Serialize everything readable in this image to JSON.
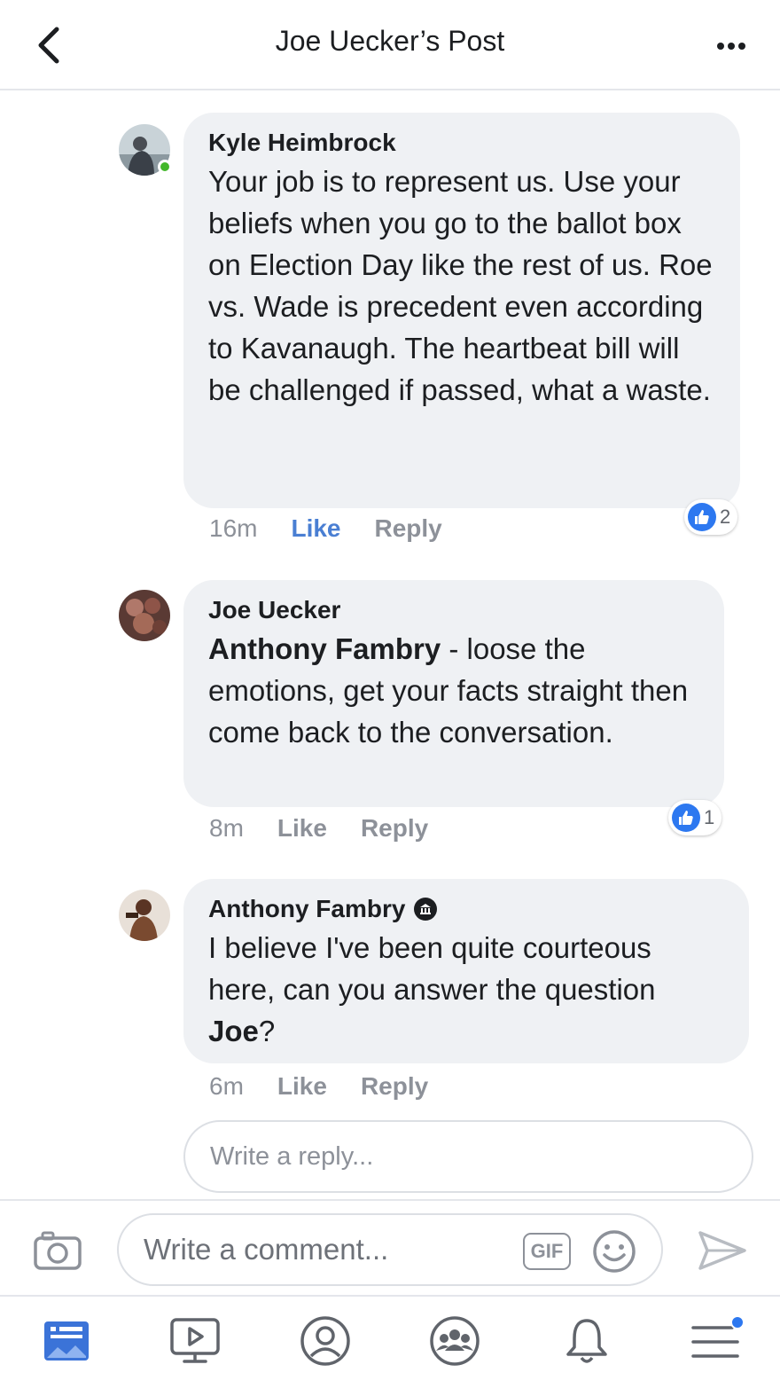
{
  "header": {
    "title": "Joe Uecker’s Post"
  },
  "comments": [
    {
      "author": "Kyle Heimbrock",
      "text": "Your job is to represent us. Use your beliefs when you go to the ballot box on Election Day like the rest of us. Roe vs. Wade is precedent even according to Kavanaugh. The heartbeat bill will be challenged if passed, what a waste.",
      "time": "16m",
      "like_label": "Like",
      "reply_label": "Reply",
      "reaction_count": "2",
      "liked": true,
      "online": true
    },
    {
      "author": "Joe Uecker",
      "mention": "Anthony Fambry",
      "text": " - loose the emotions, get your facts straight then come back to the conversation.",
      "time": "8m",
      "like_label": "Like",
      "reply_label": "Reply",
      "reaction_count": "1",
      "liked": false
    },
    {
      "author": "Anthony Fambry",
      "text": "I believe I've been quite courteous here, can you answer the question ",
      "mention": "Joe",
      "text_end": "?",
      "time": "6m",
      "like_label": "Like",
      "reply_label": "Reply",
      "liked": false
    }
  ],
  "reply_box": {
    "placeholder": "Write a reply..."
  },
  "composer": {
    "placeholder": "Write a comment...",
    "gif_label": "GIF"
  },
  "tabbar": {
    "items": [
      "news-feed",
      "watch",
      "profile",
      "groups",
      "notifications",
      "menu"
    ],
    "active": "news-feed",
    "menu_badge": true
  },
  "colors": {
    "accent": "#2d78f0",
    "like_active": "#4a7fd3",
    "bubble": "#eff1f4",
    "muted": "#8d9199"
  }
}
